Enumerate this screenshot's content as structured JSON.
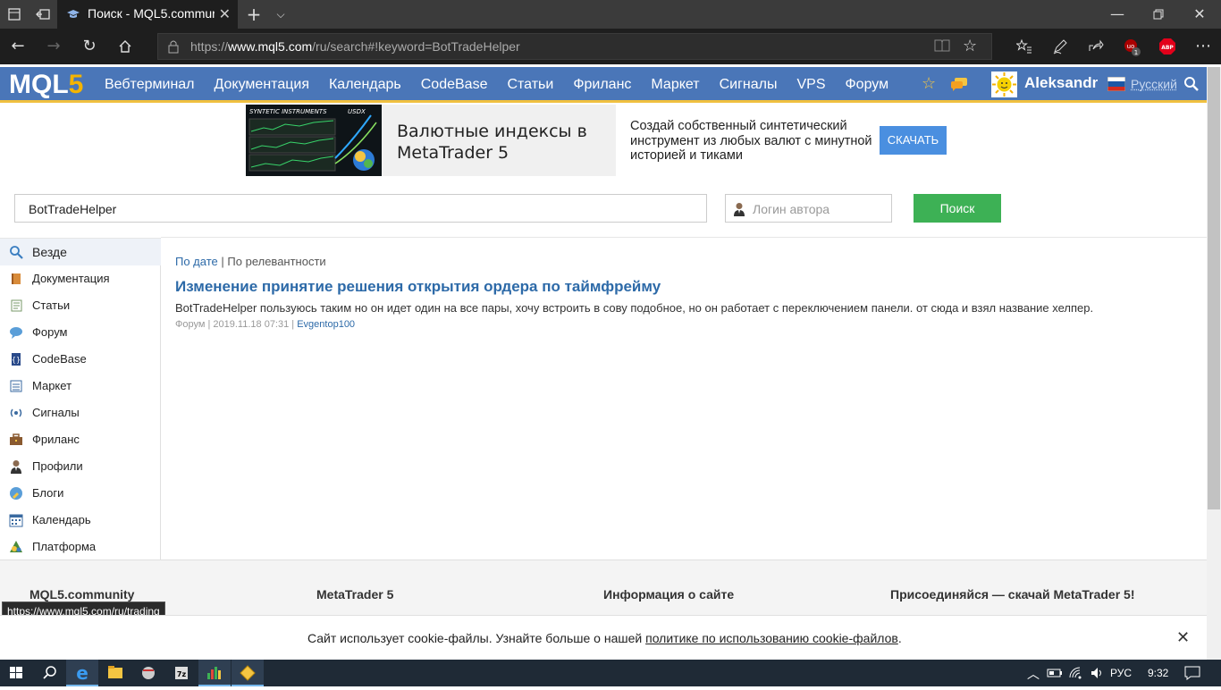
{
  "browser": {
    "tab_title": "Поиск - MQL5.commur",
    "url_prefix": "https://",
    "url_domain": "www.mql5.com",
    "url_rest": "/ru/search#!keyword=BotTradeHelper"
  },
  "header": {
    "logo_main": "MQL",
    "logo_num": "5",
    "nav": [
      "Вебтерминал",
      "Документация",
      "Календарь",
      "CodeBase",
      "Статьи",
      "Фриланс",
      "Маркет",
      "Сигналы",
      "VPS",
      "Форум"
    ],
    "username": "Aleksandr",
    "language": "Русский"
  },
  "banner": {
    "image_label_left": "SYNTETIC INSTRUMENTS",
    "image_label_right": "USDX",
    "headline": "Валютные индексы в MetaTrader 5",
    "description": "Создай собственный синтетический инструмент из любых валют с минутной историей и тиками",
    "button": "СКАЧАТЬ"
  },
  "search": {
    "query": "BotTradeHelper",
    "author_placeholder": "Логин автора",
    "button": "Поиск"
  },
  "sidebar": {
    "items": [
      {
        "label": "Везде",
        "icon": "search-icon"
      },
      {
        "label": "Документация",
        "icon": "book-icon"
      },
      {
        "label": "Статьи",
        "icon": "article-icon"
      },
      {
        "label": "Форум",
        "icon": "chat-bubble-icon"
      },
      {
        "label": "CodeBase",
        "icon": "code-icon"
      },
      {
        "label": "Маркет",
        "icon": "market-icon"
      },
      {
        "label": "Сигналы",
        "icon": "signal-icon"
      },
      {
        "label": "Фриланс",
        "icon": "briefcase-icon"
      },
      {
        "label": "Профили",
        "icon": "person-icon"
      },
      {
        "label": "Блоги",
        "icon": "blog-icon"
      },
      {
        "label": "Календарь",
        "icon": "calendar-icon"
      },
      {
        "label": "Платформа",
        "icon": "platform-icon"
      }
    ]
  },
  "results": {
    "sort_by_date": "По дате",
    "sort_separator": "|",
    "sort_by_relevance": "По релевантности",
    "items": [
      {
        "title": "Изменение принятие решения открытия ордера по таймфрейму",
        "snippet_highlight": "BotTradeHelper",
        "snippet": " пользуюсь таким но он идет один на все пары, хочу встроить в сову подобное, но он работает с переключением панели. от сюда и взял название хелпер.",
        "section": "Форум",
        "sep1": "|",
        "datetime": "2019.11.18 07:31",
        "sep2": "|",
        "author": "Evgentop100"
      }
    ]
  },
  "footer": {
    "cols": [
      "MQL5.community",
      "MetaTrader 5",
      "Информация о сайте",
      "Присоединяйся — скачай MetaTrader 5!"
    ]
  },
  "status_url": "https://www.mql5.com/ru/trading",
  "cookie": {
    "text_before": "Сайт использует cookie-файлы. Узнайте больше о нашей ",
    "link": "политике по использованию cookie-файлов",
    "text_after": "."
  },
  "taskbar": {
    "lang": "РУС",
    "time": "9:32"
  },
  "colors": {
    "header_blue": "#4a76b8",
    "accent_yellow": "#f0c040",
    "link_blue": "#2d6aa8",
    "search_green": "#3db155",
    "banner_button": "#4a8fe0"
  }
}
